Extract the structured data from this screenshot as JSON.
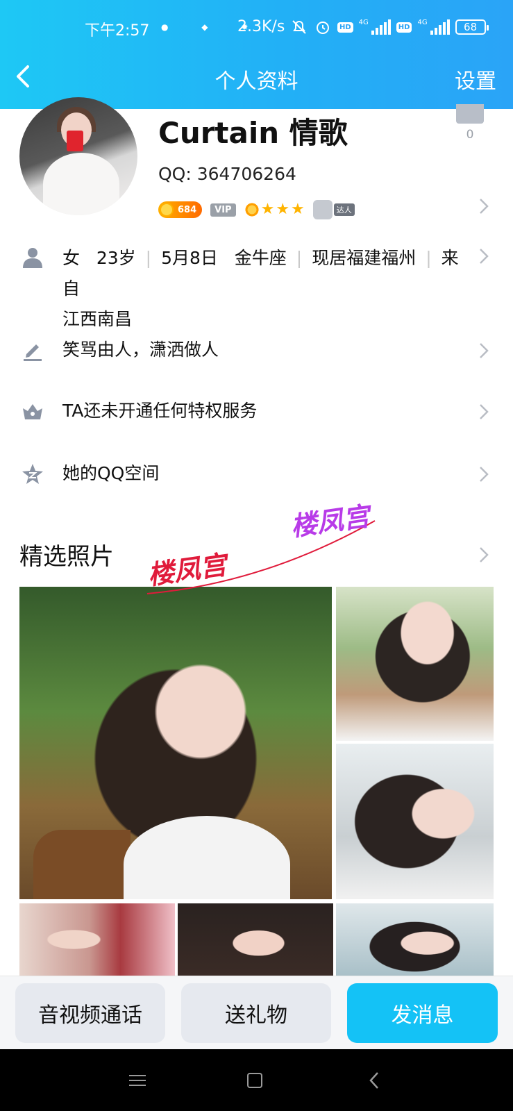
{
  "status_bar": {
    "time": "下午2:57",
    "speed": "2.3K/s",
    "network_label": "4G",
    "hd_label": "HD",
    "battery": "68"
  },
  "navbar": {
    "title": "个人资料",
    "settings_label": "设置"
  },
  "profile": {
    "name": "Curtain 情歌",
    "qq_label": "QQ: 364706264",
    "level_value": "684",
    "vip_label": "VIP",
    "daren_label": "达人",
    "like_count": "0"
  },
  "info": {
    "gender": "女",
    "age": "23岁",
    "birthday": "5月8日",
    "zodiac": "金牛座",
    "location": "现居福建福州",
    "hometown_prefix": "来自",
    "hometown": "江西南昌",
    "signature": "笑骂由人，潇洒做人",
    "privilege": "TA还未开通任何特权服务",
    "qzone": "她的QQ空间"
  },
  "photos_section": {
    "title": "精选照片",
    "watermark_text": "楼凤宫"
  },
  "actions": {
    "call": "音视频通话",
    "gift": "送礼物",
    "message": "发消息"
  },
  "colors": {
    "header_start": "#1ec8f5",
    "header_end": "#2aa4f7",
    "primary_button": "#14c2f6",
    "secondary_button": "#e6e9ef",
    "watermark_red": "#e01b3b",
    "watermark_purple": "#b83be8"
  }
}
